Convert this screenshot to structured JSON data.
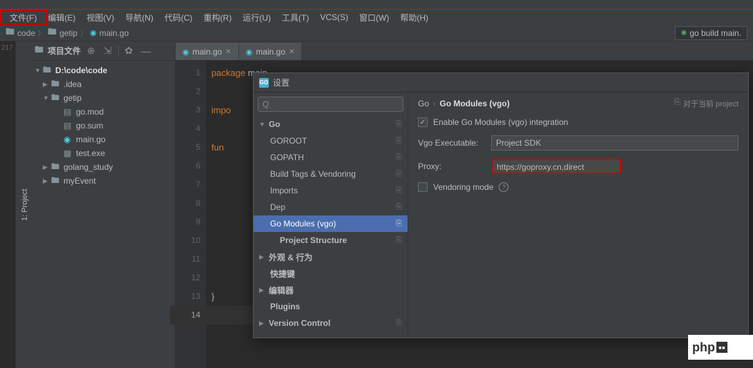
{
  "menu": [
    "文件(F)",
    "编辑(E)",
    "视图(V)",
    "导航(N)",
    "代码(C)",
    "重构(R)",
    "运行(U)",
    "工具(T)",
    "VCS(S)",
    "窗口(W)",
    "帮助(H)"
  ],
  "breadcrumb": {
    "code": "code",
    "getip": "getip",
    "main": "main.go"
  },
  "runBtn": "go build main.",
  "sidebarTab": "1: Project",
  "leftNum": "217",
  "project": {
    "header": "项目文件",
    "root": "D:\\code\\code",
    "idea": ".idea",
    "getip": "getip",
    "gomod": "go.mod",
    "gosum": "go.sum",
    "maingo": "main.go",
    "testexe": "test.exe",
    "study": "golang_study",
    "myevent": "myEvent"
  },
  "tabs": {
    "t1": "main.go",
    "t2": "main.go"
  },
  "code": {
    "package": "package",
    "main": "main",
    "import": "impo",
    "func": "fun",
    "brace": "}"
  },
  "settings": {
    "title": "设置",
    "searchPlaceholder": "",
    "go": "Go",
    "goroot": "GOROOT",
    "gopath": "GOPATH",
    "buildtags": "Build Tags & Vendoring",
    "imports": "Imports",
    "dep": "Dep",
    "gomodules": "Go Modules (vgo)",
    "projstruct": "Project Structure",
    "appearance": "外观 & 行为",
    "keymap": "快捷键",
    "editor": "编辑器",
    "plugins": "Plugins",
    "versioncontrol": "Version Control",
    "breadcrumb": {
      "go": "Go",
      "arrow": "›",
      "gomod": "Go Modules (vgo)"
    },
    "projnote": "对于当前 project",
    "enableLabel": "Enable Go Modules (vgo) integration",
    "vgoExec": "Vgo Executable:",
    "projectSDK": "Project SDK",
    "proxy": "Proxy:",
    "proxyValue": "https://goproxy.cn,direct",
    "vendoring": "Vendoring mode"
  },
  "phpBadge": "php"
}
